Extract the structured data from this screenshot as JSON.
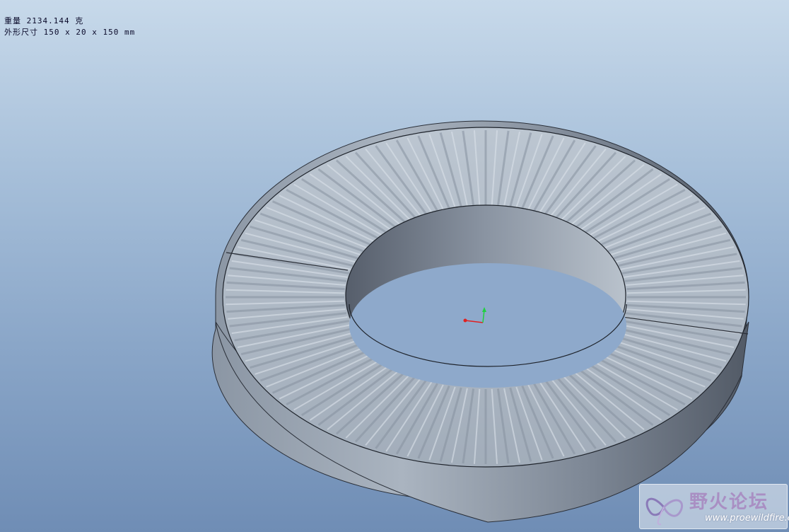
{
  "model_info": {
    "mass_line": "重量 2134.144 克",
    "size_line": "外形尺寸 150 x 20 x 150 mm"
  },
  "viewport": {
    "background_top": "#c7d9ea",
    "background_bottom": "#6f8db5",
    "model_color": "#9aa6b4",
    "model_dark": "#565e6a",
    "model_light": "#c3ccd6"
  },
  "triad": {
    "x_color": "#e02020",
    "y_color": "#20d040"
  },
  "watermark": {
    "title": "野火论坛",
    "url": "www.proewildfire.cn"
  }
}
